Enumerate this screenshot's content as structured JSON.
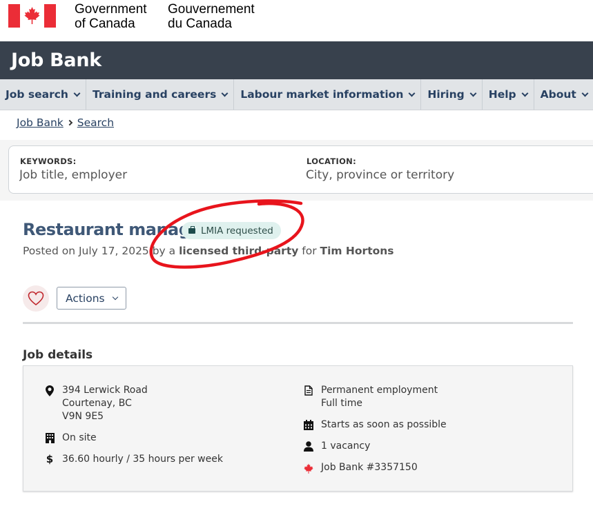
{
  "gov": {
    "name_en": "Government\nof Canada",
    "name_fr": "Gouvernement\ndu Canada",
    "flag_color": "#eb2d37"
  },
  "app": {
    "title": "Job Bank",
    "bar_color": "#38414d"
  },
  "nav": {
    "items": [
      {
        "label": "Job search"
      },
      {
        "label": "Training and careers"
      },
      {
        "label": "Labour market information"
      },
      {
        "label": "Hiring"
      },
      {
        "label": "Help"
      },
      {
        "label": "About"
      }
    ]
  },
  "breadcrumb": [
    "Job Bank",
    "Search"
  ],
  "search": {
    "keywords_label": "KEYWORDS:",
    "keywords_placeholder": "Job title, employer",
    "location_label": "LOCATION:",
    "location_placeholder": "City, province or territory"
  },
  "job": {
    "title": "Restaurant manager",
    "badge": "LMIA requested",
    "posted_prefix": "Posted on July 17, 2025 by a ",
    "poster": "licensed third-party",
    "for_word": " for ",
    "employer": "Tim Hortons"
  },
  "actions": {
    "label": "Actions",
    "favourite_icon": "heart-icon"
  },
  "details": {
    "heading": "Job details",
    "address": [
      "394 Lerwick Road",
      "Courtenay, BC",
      "V9N 9E5"
    ],
    "workplace": "On site",
    "salary": "36.60 hourly / 35 hours per week",
    "employment": [
      "Permanent employment",
      "Full time"
    ],
    "start": "Starts as soon as possible",
    "vacancy": "1 vacancy",
    "job_number": "Job Bank #3357150"
  },
  "colors": {
    "accent": "#284162",
    "annotation": "#e8141c",
    "badge_bg": "#dff1ee"
  }
}
